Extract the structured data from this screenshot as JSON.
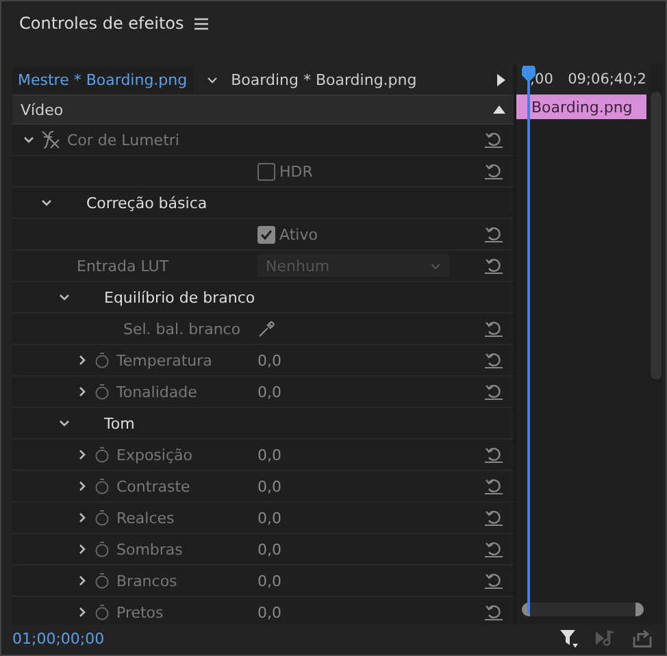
{
  "panel": {
    "title": "Controles de efeitos"
  },
  "tabs": [
    {
      "label": "Mestre * Boarding.png",
      "selected": true
    },
    {
      "label": "Boarding * Boarding.png",
      "selected": false
    }
  ],
  "section": {
    "label": "Vídeo"
  },
  "effects": [
    {
      "kind": "effect",
      "label": "Cor de Lumetri",
      "expanded": true,
      "children": [
        {
          "kind": "checkbox",
          "label": "HDR",
          "checked": false
        },
        {
          "kind": "section",
          "label": "Correção básica",
          "expanded": true,
          "children": [
            {
              "kind": "checkbox",
              "label": "Ativo",
              "checked": true
            },
            {
              "kind": "dropdown",
              "label": "Entrada LUT",
              "value": "Nenhum"
            },
            {
              "kind": "section",
              "label": "Equilíbrio de branco",
              "expanded": true,
              "children": [
                {
                  "kind": "eyedropper",
                  "label": "Sel. bal. branco"
                },
                {
                  "kind": "param",
                  "label": "Temperatura",
                  "value": "0,0",
                  "expanded": false
                },
                {
                  "kind": "param",
                  "label": "Tonalidade",
                  "value": "0,0",
                  "expanded": false
                }
              ]
            },
            {
              "kind": "section",
              "label": "Tom",
              "expanded": true,
              "children": [
                {
                  "kind": "param",
                  "label": "Exposição",
                  "value": "0,0",
                  "expanded": false
                },
                {
                  "kind": "param",
                  "label": "Contraste",
                  "value": "0,0",
                  "expanded": false
                },
                {
                  "kind": "param",
                  "label": "Realces",
                  "value": "0,0",
                  "expanded": false
                },
                {
                  "kind": "param",
                  "label": "Sombras",
                  "value": "0,0",
                  "expanded": false
                },
                {
                  "kind": "param",
                  "label": "Brancos",
                  "value": "0,0",
                  "expanded": false
                },
                {
                  "kind": "param",
                  "label": "Pretos",
                  "value": "0,0",
                  "expanded": false
                }
              ]
            }
          ]
        }
      ]
    }
  ],
  "timeline": {
    "ruler": [
      ";00",
      "09;06;40;2"
    ],
    "clip": "Boarding.png"
  },
  "timecode": "01;00;00;00"
}
